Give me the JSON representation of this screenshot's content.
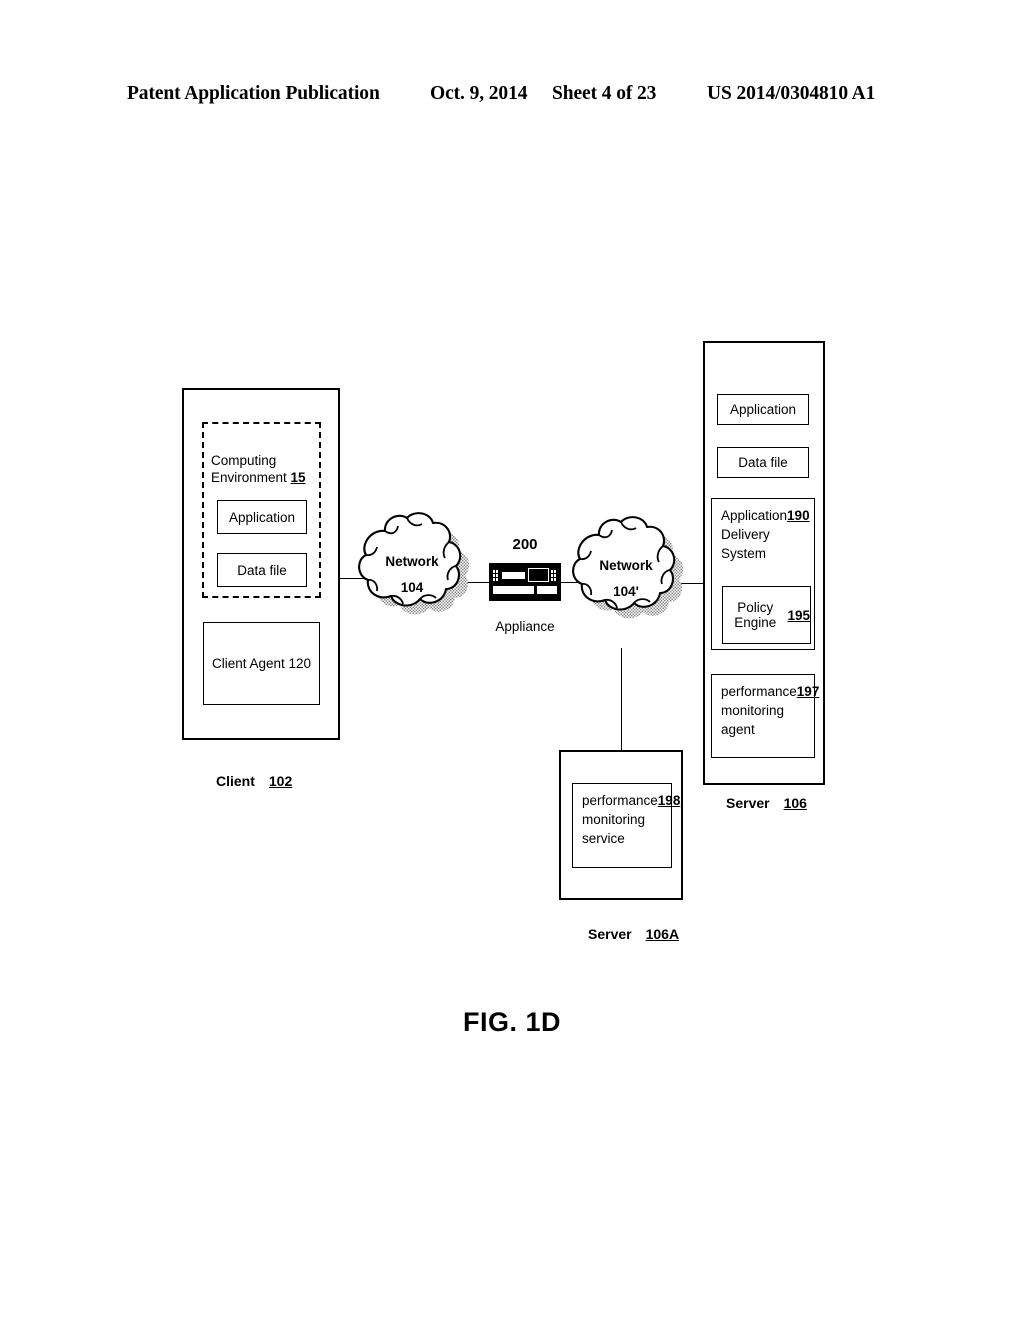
{
  "header": {
    "publication": "Patent Application Publication",
    "date": "Oct. 9, 2014",
    "sheet": "Sheet 4 of 23",
    "doc_number": "US 2014/0304810 A1"
  },
  "figure": {
    "caption": "FIG. 1D",
    "client": {
      "caption_label": "Client",
      "caption_ref": "102",
      "computing_environment": {
        "label": "Computing\nEnvironment ",
        "ref": "15",
        "application": "Application",
        "data_file": "Data file"
      },
      "client_agent": "Client Agent 120"
    },
    "network_left": {
      "name": "Network",
      "ref": "104"
    },
    "network_right": {
      "name": "Network",
      "ref": "104'"
    },
    "appliance": {
      "ref": "200",
      "name": "Appliance"
    },
    "server": {
      "caption_label": "Server",
      "caption_ref": "106",
      "application": "Application",
      "data_file": "Data file",
      "application_delivery_system": {
        "label": "Application\nDelivery\nSystem ",
        "ref": "190"
      },
      "policy_engine": {
        "label": "Policy Engine\n",
        "ref": "195"
      },
      "performance_monitoring_agent": {
        "label": "performance\nmonitoring agent\n",
        "ref": "197"
      }
    },
    "server_a": {
      "caption_label": "Server",
      "caption_ref": "106A",
      "performance_monitoring_service": {
        "label": "performance\nmonitoring\nservice ",
        "ref": "198"
      }
    }
  }
}
